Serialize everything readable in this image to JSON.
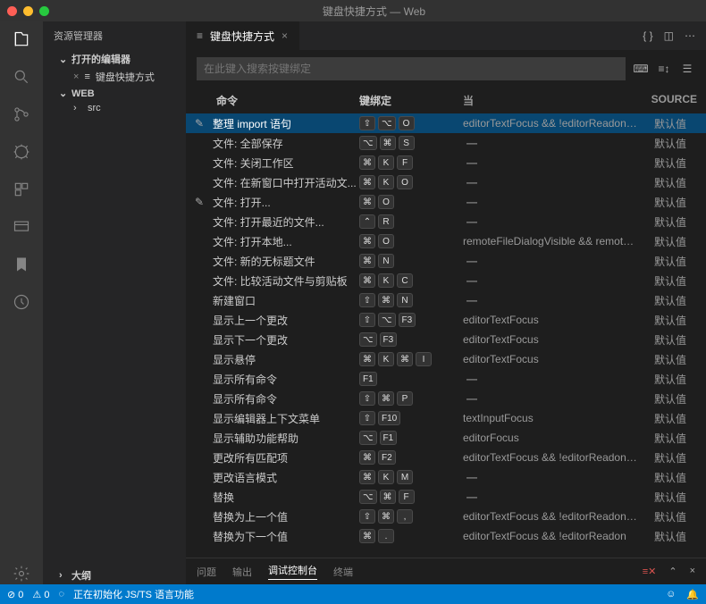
{
  "title": "键盘快捷方式 — Web",
  "sidebar": {
    "title": "资源管理器",
    "open_editors": "打开的编辑器",
    "open_item": "键盘快捷方式",
    "folder": "WEB",
    "src": "src",
    "outline": "大纲"
  },
  "tab": {
    "label": "键盘快捷方式"
  },
  "search": {
    "placeholder": "在此键入搜索按键绑定"
  },
  "columns": {
    "cmd": "命令",
    "key": "键绑定",
    "when": "当",
    "source": "SOURCE"
  },
  "default_source": "默认值",
  "rows": [
    {
      "cmd": "整理 import 语句",
      "keys": [
        "⇧",
        "⌥",
        "O"
      ],
      "when": "editorTextFocus && !editorReadon…",
      "sel": true,
      "pencil": true
    },
    {
      "cmd": "文件: 全部保存",
      "keys": [
        "⌥",
        "⌘",
        "S"
      ],
      "when": "—"
    },
    {
      "cmd": "文件: 关闭工作区",
      "keys": [
        "⌘",
        "K",
        "F"
      ],
      "when": "—"
    },
    {
      "cmd": "文件: 在新窗口中打开活动文...",
      "keys": [
        "⌘",
        "K",
        "O"
      ],
      "when": "—"
    },
    {
      "cmd": "文件: 打开...",
      "keys": [
        "⌘",
        "O"
      ],
      "when": "—",
      "pencil": true
    },
    {
      "cmd": "文件: 打开最近的文件...",
      "keys": [
        "⌃",
        "R"
      ],
      "when": "—"
    },
    {
      "cmd": "文件: 打开本地...",
      "keys": [
        "⌘",
        "O"
      ],
      "when": "remoteFileDialogVisible && remot…"
    },
    {
      "cmd": "文件: 新的无标题文件",
      "keys": [
        "⌘",
        "N"
      ],
      "when": "—"
    },
    {
      "cmd": "文件: 比较活动文件与剪贴板",
      "keys": [
        "⌘",
        "K",
        "C"
      ],
      "when": "—"
    },
    {
      "cmd": "新建窗口",
      "keys": [
        "⇧",
        "⌘",
        "N"
      ],
      "when": "—"
    },
    {
      "cmd": "显示上一个更改",
      "keys": [
        "⇧",
        "⌥",
        "F3"
      ],
      "when": "editorTextFocus"
    },
    {
      "cmd": "显示下一个更改",
      "keys": [
        "⌥",
        "F3"
      ],
      "when": "editorTextFocus"
    },
    {
      "cmd": "显示悬停",
      "keys": [
        "⌘",
        "K",
        "⌘",
        "I"
      ],
      "when": "editorTextFocus"
    },
    {
      "cmd": "显示所有命令",
      "keys": [
        "F1"
      ],
      "when": "—"
    },
    {
      "cmd": "显示所有命令",
      "keys": [
        "⇧",
        "⌘",
        "P"
      ],
      "when": "—"
    },
    {
      "cmd": "显示编辑器上下文菜单",
      "keys": [
        "⇧",
        "F10"
      ],
      "when": "textInputFocus"
    },
    {
      "cmd": "显示辅助功能帮助",
      "keys": [
        "⌥",
        "F1"
      ],
      "when": "editorFocus"
    },
    {
      "cmd": "更改所有匹配项",
      "keys": [
        "⌘",
        "F2"
      ],
      "when": "editorTextFocus && !editorReadon…"
    },
    {
      "cmd": "更改语言模式",
      "keys": [
        "⌘",
        "K",
        "M"
      ],
      "when": "—"
    },
    {
      "cmd": "替换",
      "keys": [
        "⌥",
        "⌘",
        "F"
      ],
      "when": "—"
    },
    {
      "cmd": "替换为上一个值",
      "keys": [
        "⇧",
        "⌘",
        ","
      ],
      "when": "editorTextFocus && !editorReadon…"
    },
    {
      "cmd": "替换为下一个值",
      "keys": [
        "⌘",
        "."
      ],
      "when": "editorTextFocus && !editorReadon"
    }
  ],
  "panel": {
    "problems": "问题",
    "output": "输出",
    "debug": "调试控制台",
    "terminal": "终端"
  },
  "status": {
    "errors": "0",
    "warnings": "0",
    "msg": "正在初始化 JS/TS 语言功能"
  }
}
